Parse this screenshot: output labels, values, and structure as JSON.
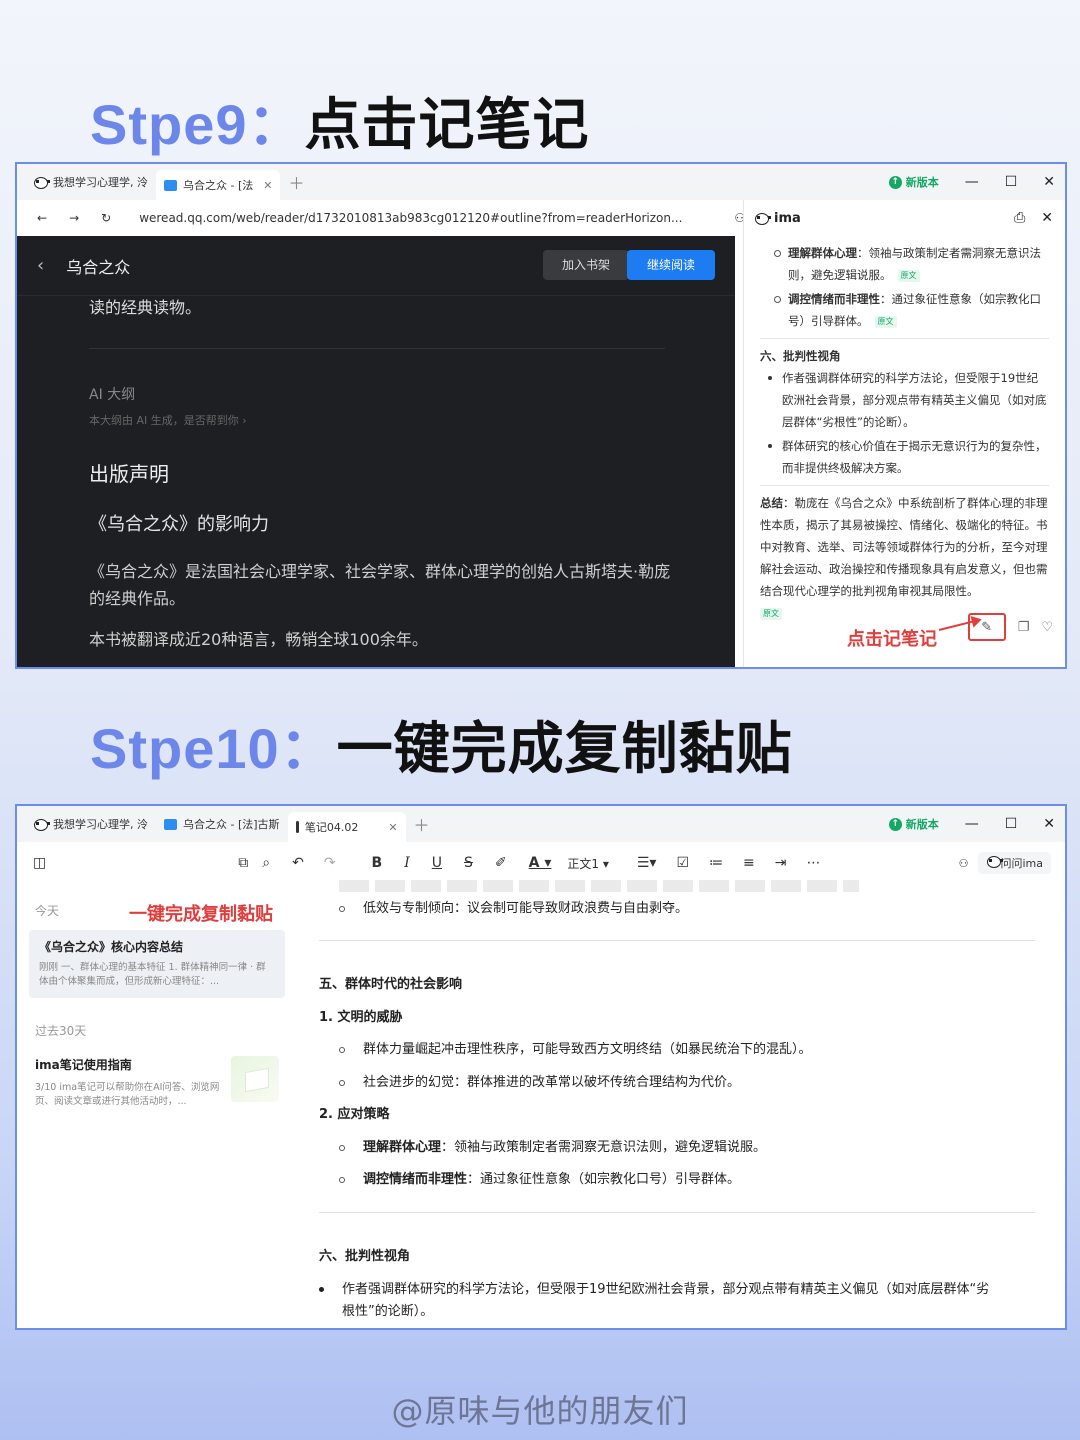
{
  "step9": {
    "prefix": "Stpe9：",
    "title": "点击记笔记"
  },
  "step10": {
    "prefix": "Stpe10：",
    "title": "一键完成复制黏贴"
  },
  "browser1": {
    "tabs": [
      {
        "label": "我想学习心理学, 泠"
      },
      {
        "label": "乌合之众 - [法"
      }
    ],
    "new_version": "新版本",
    "url": "weread.qq.com/web/reader/d1732010813ab983cg012120#outline?from=readerHorizon..."
  },
  "reader": {
    "book_title": "乌合之众",
    "add_shelf": "加入书架",
    "continue_read": "继续阅读",
    "line1": "读的经典读物。",
    "ai_outline": "AI 大纲",
    "ai_note": "本大纲由 AI 生成，是否帮到你 ›",
    "pub_statement": "出版声明",
    "influence": "《乌合之众》的影响力",
    "para1": "《乌合之众》是法国社会心理学家、社会学家、群体心理学的创始人古斯塔夫·勒庞的经典作品。",
    "para2": "本书被翻译成近20种语言，畅销全球100余年。"
  },
  "ima": {
    "title": "ima",
    "src_tag": "原文",
    "sub1_bold": "理解群体心理",
    "sub1_text": "：领袖与政策制定者需洞察无意识法则，避免逻辑说服。",
    "sub2_bold": "调控情绪而非理性",
    "sub2_text": "：通过象征性意象（如宗教化口号）引导群体。",
    "sec6": "六、批判性视角",
    "b1": "作者强调群体研究的科学方法论，但受限于19世纪欧洲社会背景，部分观点带有精英主义偏见（如对底层群体“劣根性”的论断）。",
    "b2": "群体研究的核心价值在于揭示无意识行为的复杂性，而非提供终极解决方案。",
    "summary_bold": "总结",
    "summary_text": "：勒庞在《乌合之众》中系统剖析了群体心理的非理性本质，揭示了其易被操控、情绪化、极端化的特征。书中对教育、选举、司法等领域群体行为的分析，至今对理解社会运动、政治操控和传播现象具有启发意义，但也需结合现代心理学的批判视角审视其局限性。",
    "annotation": "点击记笔记"
  },
  "browser2": {
    "tabs": [
      {
        "label": "我想学习心理学, 泠"
      },
      {
        "label": "乌合之众 - [法]古斯"
      },
      {
        "label": "笔记04.02"
      }
    ],
    "new_version": "新版本",
    "toolbar_text_style": "正文1",
    "ask_ima": "问问ima"
  },
  "notes": {
    "today": "今天",
    "annotation": "一键完成复制黏贴",
    "note1_title": "《乌合之众》核心内容总结",
    "note1_snippet": "刚刚  一、群体心理的基本特征    1. 群体精神同一律    · 群体由个体聚集而成，但形成新心理特征：...",
    "past30": "过去30天",
    "note2_title": "ima笔记使用指南",
    "note2_snippet": "3/10  ima笔记可以帮助你在AI问答、浏览网页、阅读文章或进行其他活动时，..."
  },
  "doc": {
    "line_top": "低效与专制倾向：议会制可能导致财政浪费与自由剥夺。",
    "sec5": "五、群体时代的社会影响",
    "item1": "1.   文明的威胁",
    "item1_a": "群体力量崛起冲击理性秩序，可能导致西方文明终结（如暴民统治下的混乱）。",
    "item1_b": "社会进步的幻觉：群体推进的改革常以破坏传统合理结构为代价。",
    "item2": "2.   应对策略",
    "item2_a_bold": "理解群体心理",
    "item2_a": "：领袖与政策制定者需洞察无意识法则，避免逻辑说服。",
    "item2_b_bold": "调控情绪而非理性",
    "item2_b": "：通过象征性意象（如宗教化口号）引导群体。",
    "sec6": "六、批判性视角",
    "b1_line1": "作者强调群体研究的科学方法论，但受限于19世纪欧洲社会背景，部分观点带有精英主义偏见（如对底层群体“劣",
    "b1_line2": "根性”的论断）。"
  },
  "watermark": "@原味与他的朋友们"
}
